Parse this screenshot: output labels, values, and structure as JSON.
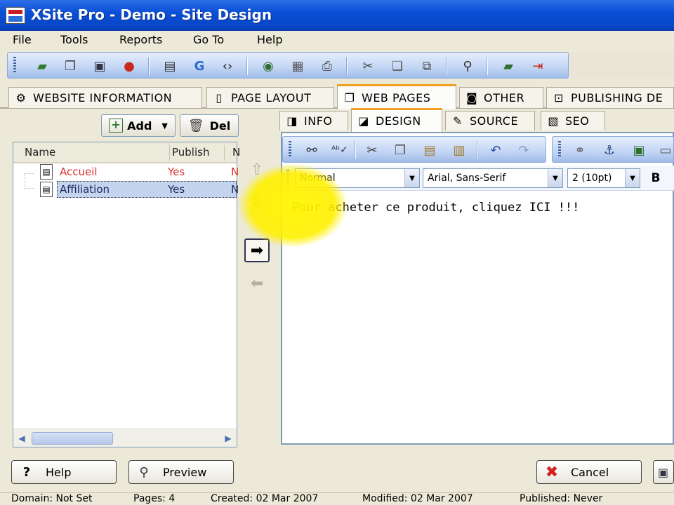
{
  "window": {
    "title": "XSite Pro - Demo - Site Design"
  },
  "menu": [
    "File",
    "Tools",
    "Reports",
    "Go To",
    "Help"
  ],
  "toolbar_icons": [
    "book-icon",
    "copy-icon",
    "save-icon",
    "stop-icon",
    "print-preview-icon",
    "google-icon",
    "code-icon",
    "globe-icon",
    "document-icon",
    "printer-icon",
    "cut-icon",
    "paste-icon",
    "multi-copy-icon",
    "search-icon",
    "notebook-icon",
    "exit-icon"
  ],
  "main_tabs": [
    "WEBSITE INFORMATION",
    "PAGE LAYOUT",
    "WEB PAGES",
    "OTHER",
    "PUBLISHING DE"
  ],
  "left": {
    "add_label": "Add",
    "del_label": "Del",
    "columns": [
      "Name",
      "Publish",
      "N"
    ],
    "rows": [
      {
        "name": "Accueil",
        "publish": "Yes",
        "n": "N",
        "color": "#d9312b"
      },
      {
        "name": "Affiliation",
        "publish": "Yes",
        "n": "N",
        "color": "#1b2a5e"
      }
    ]
  },
  "sub_tabs": [
    "INFO",
    "DESIGN",
    "SOURCE",
    "SEO"
  ],
  "format": {
    "style": "Normal",
    "font": "Arial, Sans-Serif",
    "size": "2 (10pt)",
    "bold": "B"
  },
  "editor": {
    "content": "Pour acheter ce produit, cliquez ICI !!!"
  },
  "buttons": {
    "help": "Help",
    "preview": "Preview",
    "cancel": "Cancel"
  },
  "status": {
    "domain": "Domain: Not Set",
    "pages": "Pages: 4",
    "created": "Created: 02 Mar 2007",
    "modified": "Modified: 02 Mar 2007",
    "published": "Published: Never"
  },
  "colors": {
    "titlebar": "#0a4fd6",
    "tab_accent": "#f0a020",
    "highlight": "#fff000",
    "accueil": "#d9312b"
  }
}
